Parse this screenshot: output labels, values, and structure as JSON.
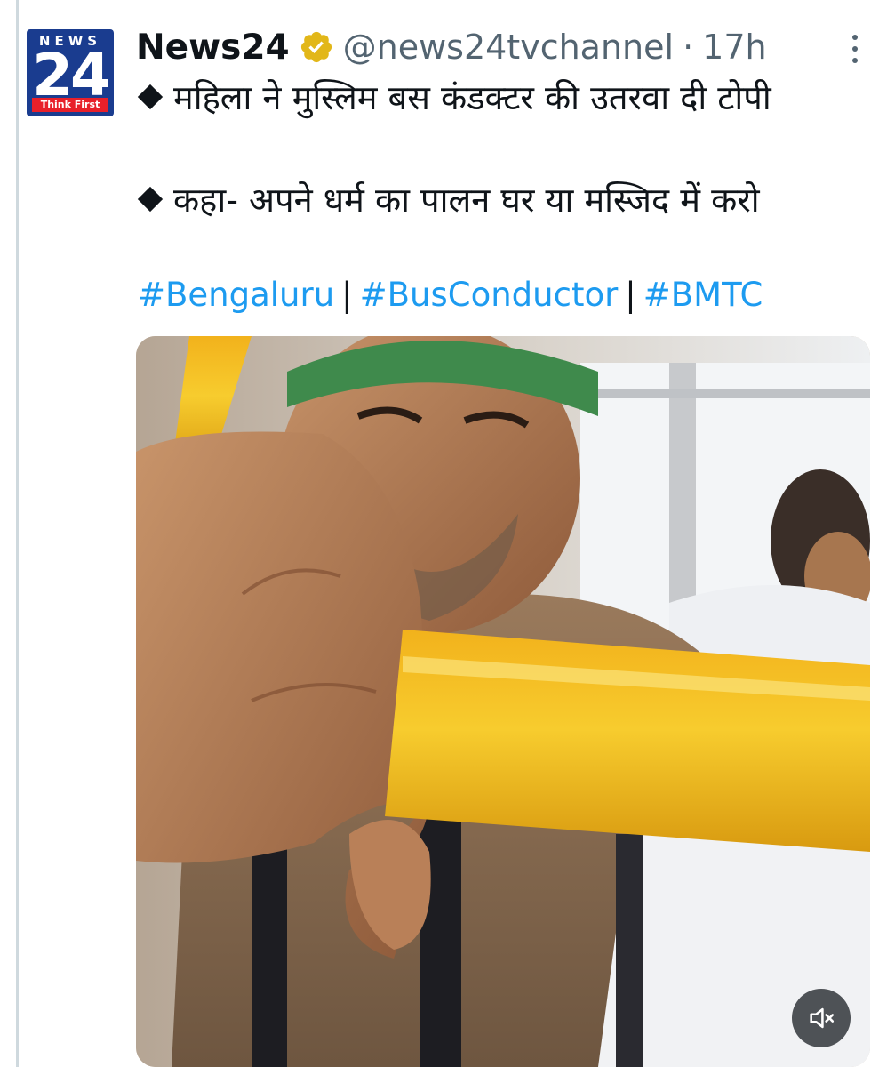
{
  "author": {
    "avatar": {
      "top_text": "NEWS",
      "number": "24",
      "tagline": "Think First",
      "bg_color": "#1a3c8f",
      "accent_color": "#e8202a"
    },
    "display_name": "News24",
    "verified_badge": "gold-verified-icon",
    "handle": "@news24tvchannel",
    "separator": "·",
    "time": "17h"
  },
  "more_menu": "more-options-icon",
  "content": {
    "line1": "महिला ने मुस्लिम बस कंडक्टर की उतरवा दी टोपी",
    "line2": "कहा- अपने धर्म का पालन घर या मस्जिद में करो",
    "bullet": "diamond-bullet-icon",
    "hashtags": [
      "#Bengaluru",
      "#BusConductor",
      "#BMTC"
    ],
    "hashtag_separator": "|"
  },
  "media": {
    "type": "video",
    "mute_control": "muted-speaker-icon"
  },
  "colors": {
    "text": "#0f1419",
    "secondary": "#536471",
    "link": "#1d9bf0",
    "verified": "#e2b719"
  }
}
